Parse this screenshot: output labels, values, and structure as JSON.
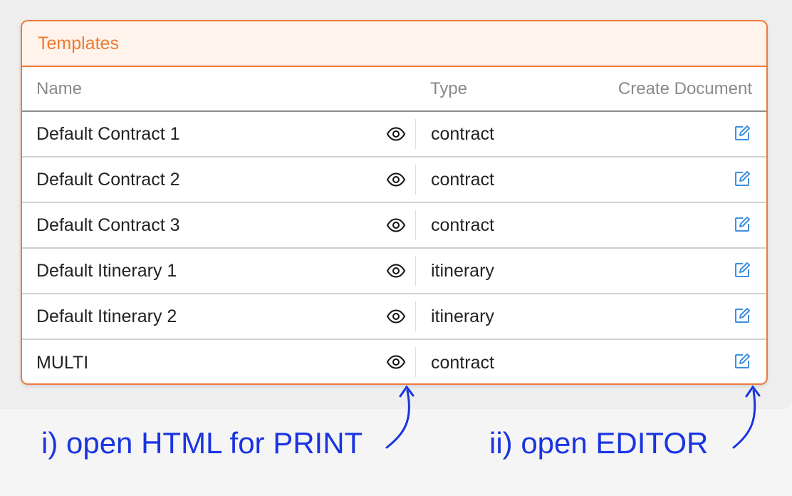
{
  "card": {
    "title": "Templates",
    "columns": {
      "name": "Name",
      "type": "Type",
      "create": "Create Document"
    },
    "rows": [
      {
        "name": "Default Contract 1",
        "type": "contract"
      },
      {
        "name": "Default Contract 2",
        "type": "contract"
      },
      {
        "name": "Default Contract 3",
        "type": "contract"
      },
      {
        "name": "Default Itinerary 1",
        "type": "itinerary"
      },
      {
        "name": "Default Itinerary 2",
        "type": "itinerary"
      },
      {
        "name": "MULTI",
        "type": "contract"
      }
    ]
  },
  "annotations": {
    "print": "i) open HTML for PRINT",
    "editor": "ii) open EDITOR"
  },
  "icons": {
    "preview": "eye-icon",
    "create": "edit-icon"
  },
  "colors": {
    "accent": "#ef7a3a",
    "header_bg": "#fff3ec",
    "edit_icon": "#3d8fe0",
    "annotation": "#1a34e0"
  }
}
